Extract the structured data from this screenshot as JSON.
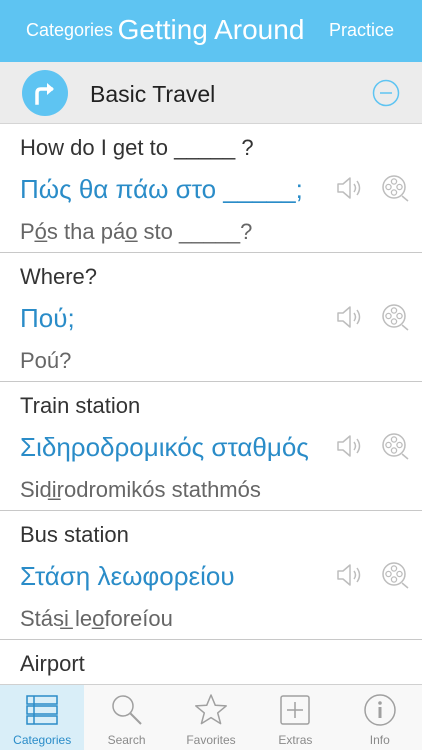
{
  "nav": {
    "left_label": "Categories",
    "title": "Getting Around",
    "right_label": "Practice"
  },
  "section": {
    "title": "Basic Travel",
    "icon": "turn-right-arrow-icon",
    "action_icon": "minus-circle-icon"
  },
  "phrases": [
    {
      "english": "How do I get to _____ ?",
      "greek": "Πώς θα πάω στο _____;",
      "transliteration": "Pó̲s tha páo̲ sto _____?"
    },
    {
      "english": "Where?",
      "greek": "Πού;",
      "transliteration": "Poú?"
    },
    {
      "english": "Train station",
      "greek": "Σιδηροδρομικός σταθμός",
      "transliteration": "Sidi̲rodromikós stathmós"
    },
    {
      "english": "Bus station",
      "greek": "Στάση λεωφορείου",
      "transliteration": "Stási̲ leo̲foreíou"
    },
    {
      "english": "Airport",
      "greek": "",
      "transliteration": ""
    }
  ],
  "tabs": [
    {
      "label": "Categories",
      "icon": "list-icon",
      "active": true
    },
    {
      "label": "Search",
      "icon": "search-icon",
      "active": false
    },
    {
      "label": "Favorites",
      "icon": "star-icon",
      "active": false
    },
    {
      "label": "Extras",
      "icon": "plus-box-icon",
      "active": false
    },
    {
      "label": "Info",
      "icon": "info-icon",
      "active": false
    }
  ],
  "colors": {
    "accent": "#5ec4f2",
    "greek_text": "#2a8cc8",
    "icon_gray": "#bdbdbd"
  }
}
